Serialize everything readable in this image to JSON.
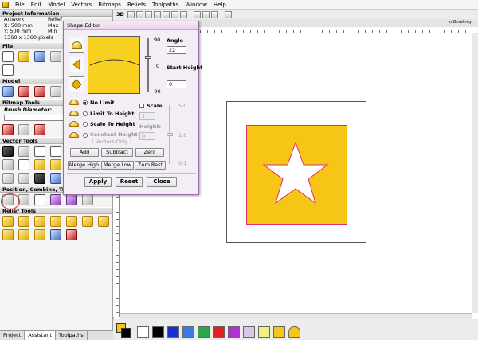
{
  "menu": {
    "items": [
      "File",
      "Edit",
      "Model",
      "Vectors",
      "Bitmaps",
      "Reliefs",
      "Toolpaths",
      "Window",
      "Help"
    ]
  },
  "toolbar": {
    "mode_3d": "3D"
  },
  "view": {
    "tab_label": "m8metrey"
  },
  "left_panel": {
    "project_info": {
      "title": "Project Information",
      "rows": [
        {
          "left": "Artwork",
          "right": "Relief"
        },
        {
          "left": "X: 500 mm",
          "right": "Max"
        },
        {
          "left": "Y: 500 mm",
          "right": "Min"
        },
        {
          "left": "1360 x 1360 pixels",
          "right": ""
        }
      ]
    },
    "sections": {
      "file": "File",
      "model": "Model",
      "bitmap_tools": "Bitmap Tools",
      "brush_diameter": "Brush Diameter:",
      "vector_tools": "Vector Tools",
      "position_combine": "Position, Combine, Trim Vectors",
      "relief_tools": "Relief Tools"
    },
    "tabs": [
      "Project",
      "Assistant",
      "Toolpaths"
    ]
  },
  "dialog": {
    "title": "Shape Editor",
    "angle_label": "Angle",
    "angle_value": "22",
    "start_height_label": "Start Height",
    "start_height_value": "0",
    "scale_ticks": [
      "90",
      "0",
      "-90"
    ],
    "options": {
      "no_limit": "No Limit",
      "limit_to_height": "Limit To Height",
      "scale_to_height": "Scale To Height",
      "constant_height": "Constant Height",
      "vectors_only": "( Vectors Only )"
    },
    "scale_label": "Scale",
    "scale_value": "1",
    "height_label": "Height:",
    "height_value": "0",
    "scale_ticks_right": [
      "5.0",
      "1.0",
      "0.1"
    ],
    "buttons": {
      "add": "Add",
      "subtract": "Subtract",
      "zero": "Zero",
      "merge_high": "Merge High",
      "merge_low": "Merge Low",
      "zero_rest": "Zero Rest",
      "apply": "Apply",
      "reset": "Reset",
      "close": "Close"
    }
  },
  "palette": {
    "colors": [
      "#ffffff",
      "#000000",
      "#1a2fd0",
      "#3a7ae8",
      "#2aa84a",
      "#e02020",
      "#b030d0",
      "#d8c8e8",
      "#f4f080",
      "#f7c515"
    ]
  },
  "canvas": {
    "fill_color": "#f7c515",
    "outline_color": "#e03060"
  }
}
